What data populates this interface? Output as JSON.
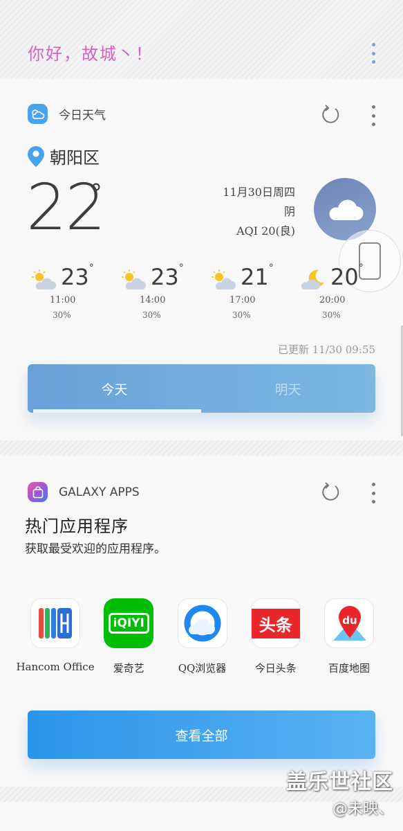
{
  "greeting": {
    "text": "你好，故城丶！"
  },
  "weather": {
    "title": "今日天气",
    "location": "朝阳区",
    "temperature": "22",
    "degree_symbol": "°",
    "date_line": "11月30日周四",
    "condition": "阴",
    "aqi": "AQI 20(良)",
    "forecast": [
      {
        "temp": "23",
        "time": "11:00",
        "pct": "30%",
        "icon": "sun-cloud-icon"
      },
      {
        "temp": "23",
        "time": "14:00",
        "pct": "30%",
        "icon": "sun-cloud-icon"
      },
      {
        "temp": "21",
        "time": "17:00",
        "pct": "30%",
        "icon": "sun-cloud-icon"
      },
      {
        "temp": "20",
        "time": "20:00",
        "pct": "30%",
        "icon": "moon-cloud-icon"
      }
    ],
    "updated": "已更新 11/30 09:55",
    "tabs": {
      "today": "今天",
      "tomorrow": "明天"
    }
  },
  "apps": {
    "title": "GALAXY APPS",
    "heading": "热门应用程序",
    "subheading": "获取最受欢迎的应用程序。",
    "items": [
      {
        "label": "Hancom Office",
        "icon": "hancom-office-icon"
      },
      {
        "label": "爱奇艺",
        "icon": "iqiyi-icon",
        "logo_text": "iQIYI"
      },
      {
        "label": "QQ浏览器",
        "icon": "qq-browser-icon"
      },
      {
        "label": "今日头条",
        "icon": "toutiao-icon",
        "logo_text": "头条"
      },
      {
        "label": "百度地图",
        "icon": "baidu-map-icon",
        "logo_text": "du"
      }
    ],
    "view_all": "查看全部"
  },
  "watermark": {
    "main": "盖乐世社区",
    "sub": "@未映、"
  },
  "colors": {
    "accent_blue": "#2b94ea",
    "weather_tab": "#6aa0d8",
    "greeting_pink": "#d85fc2",
    "iqiyi_green": "#00be06",
    "toutiao_red": "#e8262b"
  }
}
